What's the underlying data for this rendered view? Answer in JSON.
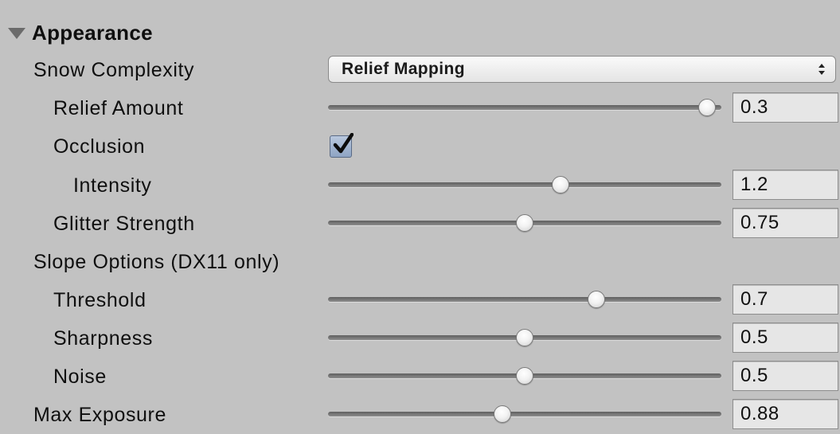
{
  "section": {
    "title": "Appearance",
    "expanded": true,
    "icon": "foldout-expanded-icon"
  },
  "snow_complexity": {
    "label": "Snow Complexity",
    "selected": "Relief Mapping",
    "icon": "up-down-arrows-icon"
  },
  "relief_amount": {
    "label": "Relief Amount",
    "value": "0.3",
    "fraction": 0.985
  },
  "occlusion": {
    "label": "Occlusion",
    "checked": true,
    "icon": "checkmark-icon"
  },
  "intensity": {
    "label": "Intensity",
    "value": "1.2",
    "fraction": 0.595
  },
  "glitter_strength": {
    "label": "Glitter Strength",
    "value": "0.75",
    "fraction": 0.5
  },
  "slope_options": {
    "label": "Slope Options (DX11 only)"
  },
  "threshold": {
    "label": "Threshold",
    "value": "0.7",
    "fraction": 0.69
  },
  "sharpness": {
    "label": "Sharpness",
    "value": "0.5",
    "fraction": 0.5
  },
  "noise": {
    "label": "Noise",
    "value": "0.5",
    "fraction": 0.5
  },
  "max_exposure": {
    "label": "Max Exposure",
    "value": "0.88",
    "fraction": 0.44
  },
  "colors": {
    "panel_background": "#c2c2c2",
    "field_background": "#e6e6e6",
    "checkbox_fill": "#9fb2cf"
  }
}
